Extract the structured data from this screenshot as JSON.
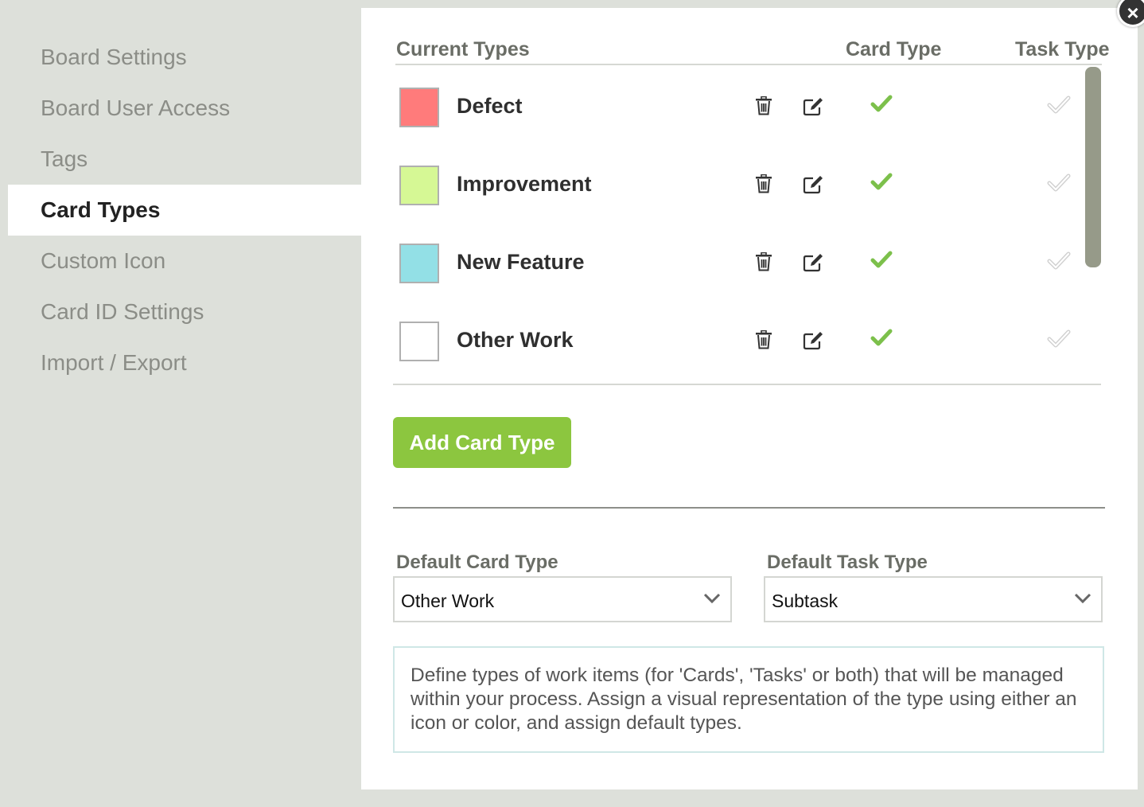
{
  "sidebar": {
    "items": [
      {
        "label": "Board Settings"
      },
      {
        "label": "Board User Access"
      },
      {
        "label": "Tags"
      },
      {
        "label": "Card Types",
        "active": true
      },
      {
        "label": "Custom Icon"
      },
      {
        "label": "Card ID Settings"
      },
      {
        "label": "Import / Export"
      }
    ]
  },
  "close_button": {
    "glyph": "×"
  },
  "table": {
    "headers": {
      "current_types": "Current Types",
      "card_type": "Card Type",
      "task_type": "Task Type"
    },
    "rows": [
      {
        "name": "Defect",
        "color": "#ff7b7b",
        "card_type": true,
        "task_type": false
      },
      {
        "name": "Improvement",
        "color": "#d6f895",
        "card_type": true,
        "task_type": false
      },
      {
        "name": "New Feature",
        "color": "#93e0e6",
        "card_type": true,
        "task_type": false
      },
      {
        "name": "Other Work",
        "color": "#ffffff",
        "card_type": true,
        "task_type": false
      }
    ]
  },
  "add_button": {
    "label": "Add Card Type"
  },
  "defaults": {
    "card": {
      "label": "Default Card Type",
      "value": "Other Work"
    },
    "task": {
      "label": "Default Task Type",
      "value": "Subtask"
    }
  },
  "info_text": "Define types of work items (for 'Cards', 'Tasks' or both) that will be managed within your process. Assign a visual representation of the type using either an icon or color, and assign default types.",
  "colors": {
    "accent_green": "#8cc63f",
    "check_on": "#7cc04b",
    "check_off": "#d0d0d0",
    "scrollbar": "#969a89"
  },
  "icons": {
    "delete": "trash-icon",
    "edit": "edit-icon",
    "enabled": "checkmark-icon",
    "disabled": "checkmark-outline-icon",
    "dropdown": "chevron-down-icon",
    "close": "close-icon"
  }
}
